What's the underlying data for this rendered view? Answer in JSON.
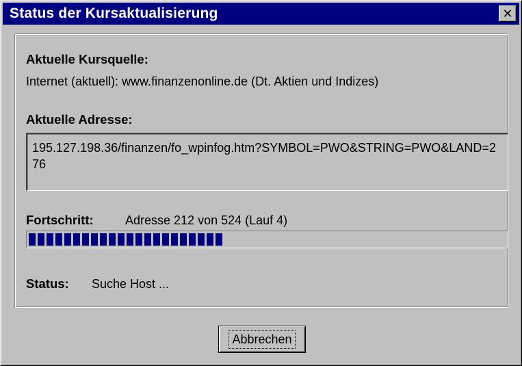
{
  "window": {
    "title": "Status der Kursaktualisierung",
    "close_glyph": "✕"
  },
  "source": {
    "label": "Aktuelle Kursquelle:",
    "value": "Internet (aktuell): www.finanzenonline.de (Dt. Aktien und Indizes)"
  },
  "address": {
    "label": "Aktuelle Adresse:",
    "value": "195.127.198.36/finanzen/fo_wpinfog.htm?SYMBOL=PWO&STRING=PWO&LAND=276"
  },
  "progress": {
    "label": "Fortschritt:",
    "text": "Adresse 212 von 524 (Lauf 4)",
    "fraction": 0.41,
    "bar_color": "#000080"
  },
  "status": {
    "label": "Status:",
    "value": "Suche Host ..."
  },
  "buttons": {
    "cancel": "Abbrechen"
  }
}
